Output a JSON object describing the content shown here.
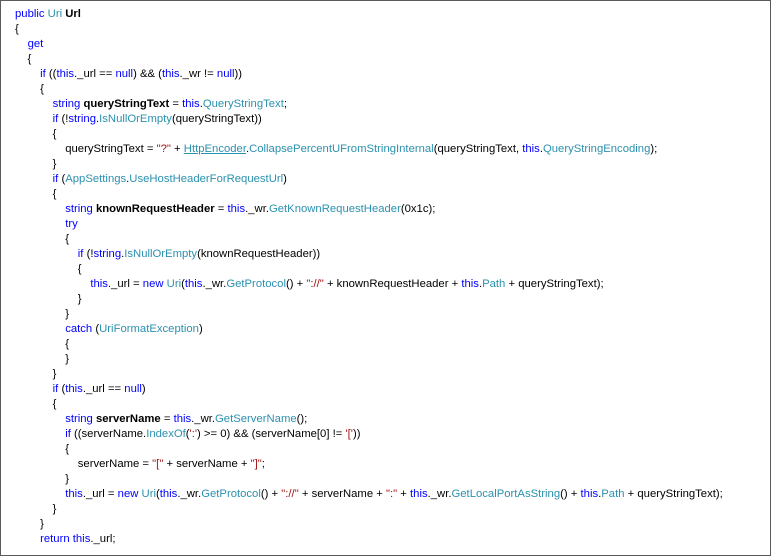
{
  "window": {
    "lines": [
      [
        {
          "t": "public ",
          "c": "kw"
        },
        {
          "t": "Uri ",
          "c": "ty"
        },
        {
          "t": "Url",
          "c": "b"
        }
      ],
      [
        {
          "t": "{"
        }
      ],
      [
        {
          "t": "    "
        },
        {
          "t": "get",
          "c": "kw"
        }
      ],
      [
        {
          "t": "    {"
        }
      ],
      [
        {
          "t": "        "
        },
        {
          "t": "if",
          "c": "kw"
        },
        {
          "t": " (("
        },
        {
          "t": "this",
          "c": "kw"
        },
        {
          "t": "._url == "
        },
        {
          "t": "null",
          "c": "kw"
        },
        {
          "t": ") && ("
        },
        {
          "t": "this",
          "c": "kw"
        },
        {
          "t": "._wr != "
        },
        {
          "t": "null",
          "c": "kw"
        },
        {
          "t": "))"
        }
      ],
      [
        {
          "t": "        {"
        }
      ],
      [
        {
          "t": "            "
        },
        {
          "t": "string",
          "c": "kw"
        },
        {
          "t": " "
        },
        {
          "t": "queryStringText",
          "c": "b"
        },
        {
          "t": " = "
        },
        {
          "t": "this",
          "c": "kw"
        },
        {
          "t": "."
        },
        {
          "t": "QueryStringText",
          "c": "ty"
        },
        {
          "t": ";"
        }
      ],
      [
        {
          "t": "            "
        },
        {
          "t": "if",
          "c": "kw"
        },
        {
          "t": " (!"
        },
        {
          "t": "string",
          "c": "kw"
        },
        {
          "t": "."
        },
        {
          "t": "IsNullOrEmpty",
          "c": "ty"
        },
        {
          "t": "(queryStringText))"
        }
      ],
      [
        {
          "t": "            {"
        }
      ],
      [
        {
          "t": "                queryStringText = "
        },
        {
          "t": "\"?\"",
          "c": "str"
        },
        {
          "t": " + "
        },
        {
          "t": "HttpEncoder",
          "c": "lnk"
        },
        {
          "t": "."
        },
        {
          "t": "CollapsePercentUFromStringInternal",
          "c": "ty"
        },
        {
          "t": "(queryStringText, "
        },
        {
          "t": "this",
          "c": "kw"
        },
        {
          "t": "."
        },
        {
          "t": "QueryStringEncoding",
          "c": "ty"
        },
        {
          "t": ");"
        }
      ],
      [
        {
          "t": "            }"
        }
      ],
      [
        {
          "t": "            "
        },
        {
          "t": "if",
          "c": "kw"
        },
        {
          "t": " ("
        },
        {
          "t": "AppSettings",
          "c": "ty"
        },
        {
          "t": "."
        },
        {
          "t": "UseHostHeaderForRequestUrl",
          "c": "ty"
        },
        {
          "t": ")"
        }
      ],
      [
        {
          "t": "            {"
        }
      ],
      [
        {
          "t": "                "
        },
        {
          "t": "string",
          "c": "kw"
        },
        {
          "t": " "
        },
        {
          "t": "knownRequestHeader",
          "c": "b"
        },
        {
          "t": " = "
        },
        {
          "t": "this",
          "c": "kw"
        },
        {
          "t": "._wr."
        },
        {
          "t": "GetKnownRequestHeader",
          "c": "ty"
        },
        {
          "t": "("
        },
        {
          "t": "0x1c",
          "c": "num"
        },
        {
          "t": ");"
        }
      ],
      [
        {
          "t": "                "
        },
        {
          "t": "try",
          "c": "kw"
        }
      ],
      [
        {
          "t": "                {"
        }
      ],
      [
        {
          "t": "                    "
        },
        {
          "t": "if",
          "c": "kw"
        },
        {
          "t": " (!"
        },
        {
          "t": "string",
          "c": "kw"
        },
        {
          "t": "."
        },
        {
          "t": "IsNullOrEmpty",
          "c": "ty"
        },
        {
          "t": "(knownRequestHeader))"
        }
      ],
      [
        {
          "t": "                    {"
        }
      ],
      [
        {
          "t": "                        "
        },
        {
          "t": "this",
          "c": "kw"
        },
        {
          "t": "._url = "
        },
        {
          "t": "new",
          "c": "kw"
        },
        {
          "t": " "
        },
        {
          "t": "Uri",
          "c": "ty"
        },
        {
          "t": "("
        },
        {
          "t": "this",
          "c": "kw"
        },
        {
          "t": "._wr."
        },
        {
          "t": "GetProtocol",
          "c": "ty"
        },
        {
          "t": "() + "
        },
        {
          "t": "\"://\"",
          "c": "str"
        },
        {
          "t": " + knownRequestHeader + "
        },
        {
          "t": "this",
          "c": "kw"
        },
        {
          "t": "."
        },
        {
          "t": "Path",
          "c": "ty"
        },
        {
          "t": " + queryStringText);"
        }
      ],
      [
        {
          "t": "                    }"
        }
      ],
      [
        {
          "t": "                }"
        }
      ],
      [
        {
          "t": "                "
        },
        {
          "t": "catch",
          "c": "kw"
        },
        {
          "t": " ("
        },
        {
          "t": "UriFormatException",
          "c": "ty"
        },
        {
          "t": ")"
        }
      ],
      [
        {
          "t": "                {"
        }
      ],
      [
        {
          "t": "                }"
        }
      ],
      [
        {
          "t": "            }"
        }
      ],
      [
        {
          "t": "            "
        },
        {
          "t": "if",
          "c": "kw"
        },
        {
          "t": " ("
        },
        {
          "t": "this",
          "c": "kw"
        },
        {
          "t": "._url == "
        },
        {
          "t": "null",
          "c": "kw"
        },
        {
          "t": ")"
        }
      ],
      [
        {
          "t": "            {"
        }
      ],
      [
        {
          "t": "                "
        },
        {
          "t": "string",
          "c": "kw"
        },
        {
          "t": " "
        },
        {
          "t": "serverName",
          "c": "b"
        },
        {
          "t": " = "
        },
        {
          "t": "this",
          "c": "kw"
        },
        {
          "t": "._wr."
        },
        {
          "t": "GetServerName",
          "c": "ty"
        },
        {
          "t": "();"
        }
      ],
      [
        {
          "t": "                "
        },
        {
          "t": "if",
          "c": "kw"
        },
        {
          "t": " ((serverName."
        },
        {
          "t": "IndexOf",
          "c": "ty"
        },
        {
          "t": "("
        },
        {
          "t": "':'",
          "c": "str"
        },
        {
          "t": ") >= "
        },
        {
          "t": "0",
          "c": "num"
        },
        {
          "t": ") && (serverName["
        },
        {
          "t": "0",
          "c": "num"
        },
        {
          "t": "] != "
        },
        {
          "t": "'['",
          "c": "str"
        },
        {
          "t": "))"
        }
      ],
      [
        {
          "t": "                {"
        }
      ],
      [
        {
          "t": "                    serverName = "
        },
        {
          "t": "\"[\"",
          "c": "str"
        },
        {
          "t": " + serverName + "
        },
        {
          "t": "\"]\"",
          "c": "str"
        },
        {
          "t": ";"
        }
      ],
      [
        {
          "t": "                }"
        }
      ],
      [
        {
          "t": "                "
        },
        {
          "t": "this",
          "c": "kw"
        },
        {
          "t": "._url = "
        },
        {
          "t": "new",
          "c": "kw"
        },
        {
          "t": " "
        },
        {
          "t": "Uri",
          "c": "ty"
        },
        {
          "t": "("
        },
        {
          "t": "this",
          "c": "kw"
        },
        {
          "t": "._wr."
        },
        {
          "t": "GetProtocol",
          "c": "ty"
        },
        {
          "t": "() + "
        },
        {
          "t": "\"://\"",
          "c": "str"
        },
        {
          "t": " + serverName + "
        },
        {
          "t": "\":\"",
          "c": "str"
        },
        {
          "t": " + "
        },
        {
          "t": "this",
          "c": "kw"
        },
        {
          "t": "._wr."
        },
        {
          "t": "GetLocalPortAsString",
          "c": "ty"
        },
        {
          "t": "() + "
        },
        {
          "t": "this",
          "c": "kw"
        },
        {
          "t": "."
        },
        {
          "t": "Path",
          "c": "ty"
        },
        {
          "t": " + queryStringText);"
        }
      ],
      [
        {
          "t": "            }"
        }
      ],
      [
        {
          "t": "        }"
        }
      ],
      [
        {
          "t": "        "
        },
        {
          "t": "return",
          "c": "kw"
        },
        {
          "t": " "
        },
        {
          "t": "this",
          "c": "kw"
        },
        {
          "t": "._url;"
        }
      ]
    ]
  },
  "colors": {
    "keyword": "#0000ff",
    "type": "#2b91af",
    "string": "#a31515",
    "text": "#000000",
    "border": "#5a5a5a"
  }
}
